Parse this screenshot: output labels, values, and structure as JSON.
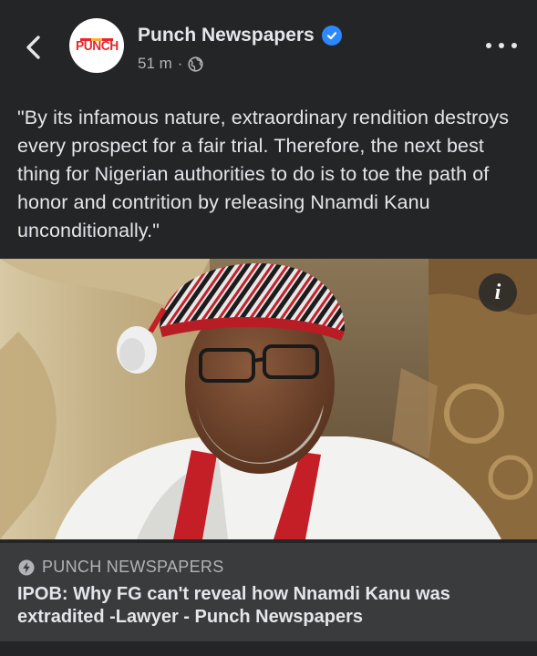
{
  "post": {
    "page_name": "Punch Newspapers",
    "avatar_logo_text": "PUNCH",
    "verified": true,
    "time_ago": "51 m",
    "separator": "·",
    "privacy_icon": "globe-icon",
    "text": "\"By its infamous nature, extraordinary rendition destroys every prospect for a fair trial. Therefore, the next best thing for Nigerian authorities to do is to toe the path of honor and contrition by releasing Nnamdi Kanu unconditionally.\"",
    "info_button_label": "i"
  },
  "link_preview": {
    "source_icon": "instant-article-bolt-icon",
    "source": "PUNCH NEWSPAPERS",
    "title": "IPOB: Why FG can't reveal how Nnamdi Kanu was extradited -Lawyer - Punch Newspapers"
  },
  "colors": {
    "background": "#242526",
    "link_box": "#3a3b3c",
    "primary_text": "#e4e6eb",
    "secondary_text": "#b0b3b8",
    "verified_blue": "#2d88ff",
    "brand_red": "#e8262b"
  }
}
